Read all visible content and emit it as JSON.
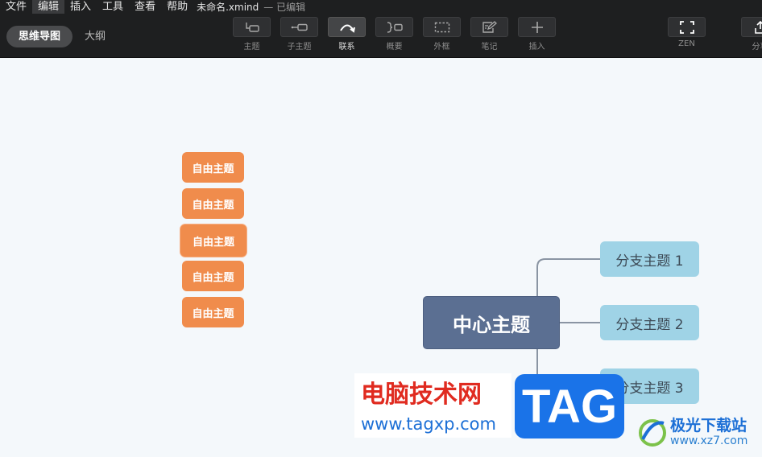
{
  "menu": {
    "items": [
      "文件",
      "编辑",
      "插入",
      "工具",
      "查看",
      "帮助"
    ],
    "active_index": 1,
    "document_title": "未命名.xmind",
    "document_status": "— 已编辑"
  },
  "view_switch": {
    "mind_map": "思维导图",
    "outline": "大纲"
  },
  "toolbar": {
    "topic": "主题",
    "subtopic": "子主题",
    "relationship": "联系",
    "summary": "概要",
    "boundary": "外框",
    "note": "笔记",
    "insert": "插入",
    "zen": "ZEN",
    "share": "分享"
  },
  "icons": {
    "topic": "topic-icon",
    "subtopic": "subtopic-icon",
    "relationship": "relationship-arrow-icon",
    "summary": "summary-bracket-icon",
    "boundary": "boundary-dashed-icon",
    "note": "note-pencil-icon",
    "insert": "plus-icon",
    "zen": "fullscreen-icon",
    "share": "share-icon"
  },
  "canvas": {
    "floating_topics": [
      "自由主题",
      "自由主题",
      "自由主题",
      "自由主题",
      "自由主题"
    ],
    "central_topic": "中心主题",
    "branches": [
      "分支主题 1",
      "分支主题 2",
      "分支主题 3"
    ]
  },
  "colors": {
    "floating_topic": "#f08c4c",
    "central_topic": "#5b6f92",
    "branch_topic": "#9fd3e6",
    "canvas_bg": "#f4f8fb",
    "toolbar_bg": "#1e1f20"
  },
  "watermark": {
    "site_cn": "电脑技术网",
    "site_url": "www.tagxp.com",
    "tag": "TAG",
    "site2_name": "极光下载站",
    "site2_url": "www.xz7.com"
  }
}
